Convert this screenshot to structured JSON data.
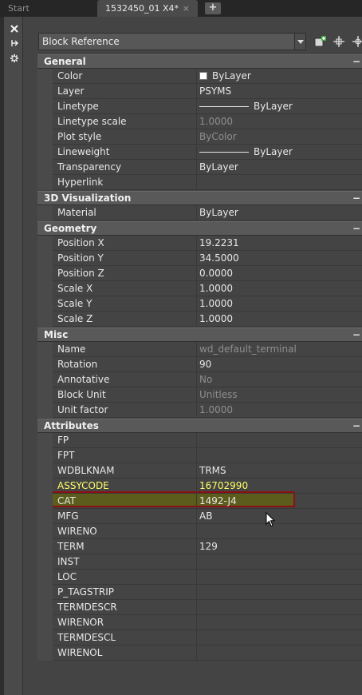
{
  "tabs": [
    {
      "label": "Start"
    },
    {
      "label": "1532450_01 X4*",
      "close": "×"
    }
  ],
  "new_tab": "+",
  "palette_icons": [
    "close-icon",
    "auto-hide-icon",
    "properties-settings-icon"
  ],
  "object_type": "Block Reference",
  "toolbar_icons": [
    "toggle-pickadd-icon",
    "select-objects-icon",
    "quick-select-icon"
  ],
  "colors": {
    "background": "#444444",
    "category_header": "#595959",
    "selected_text": "#ffff66",
    "selected_row_fill": "#5c5d1c",
    "highlight_border": "#8c0f12"
  },
  "categories": [
    {
      "title": "General",
      "toggle": "−",
      "rows": [
        {
          "name": "Color",
          "value": "ByLayer",
          "swatch": "white"
        },
        {
          "name": "Layer",
          "value": "PSYMS"
        },
        {
          "name": "Linetype",
          "value": "ByLayer",
          "line": "long"
        },
        {
          "name": "Linetype scale",
          "value": "1.0000",
          "muted": true
        },
        {
          "name": "Plot style",
          "value": "ByColor",
          "muted": true
        },
        {
          "name": "Lineweight",
          "value": "ByLayer",
          "line": "long"
        },
        {
          "name": "Transparency",
          "value": "ByLayer"
        },
        {
          "name": "Hyperlink",
          "value": ""
        }
      ]
    },
    {
      "title": "3D Visualization",
      "toggle": "−",
      "rows": [
        {
          "name": "Material",
          "value": "ByLayer"
        }
      ]
    },
    {
      "title": "Geometry",
      "toggle": "−",
      "rows": [
        {
          "name": "Position X",
          "value": "19.2231"
        },
        {
          "name": "Position Y",
          "value": "34.5000"
        },
        {
          "name": "Position Z",
          "value": "0.0000"
        },
        {
          "name": "Scale X",
          "value": "1.0000"
        },
        {
          "name": "Scale Y",
          "value": "1.0000"
        },
        {
          "name": "Scale Z",
          "value": "1.0000"
        }
      ]
    },
    {
      "title": "Misc",
      "toggle": "−",
      "rows": [
        {
          "name": "Name",
          "value": "wd_default_terminal",
          "muted": true
        },
        {
          "name": "Rotation",
          "value": "90"
        },
        {
          "name": "Annotative",
          "value": "No",
          "muted": true
        },
        {
          "name": "Block Unit",
          "value": "Unitless",
          "muted": true
        },
        {
          "name": "Unit factor",
          "value": "1.0000",
          "muted": true
        }
      ]
    },
    {
      "title": "Attributes",
      "toggle": "−",
      "rows": [
        {
          "name": "FP",
          "value": ""
        },
        {
          "name": "FPT",
          "value": ""
        },
        {
          "name": "WDBLKNAM",
          "value": "TRMS"
        },
        {
          "name": "ASSYCODE",
          "value": "16702990",
          "selected": true
        },
        {
          "name": "CAT",
          "value": "1492-J4"
        },
        {
          "name": "MFG",
          "value": "AB"
        },
        {
          "name": "WIRENO",
          "value": ""
        },
        {
          "name": "TERM",
          "value": "129"
        },
        {
          "name": "INST",
          "value": ""
        },
        {
          "name": "LOC",
          "value": ""
        },
        {
          "name": "P_TAGSTRIP",
          "value": ""
        },
        {
          "name": "TERMDESCR",
          "value": ""
        },
        {
          "name": "WIRENOR",
          "value": ""
        },
        {
          "name": "TERMDESCL",
          "value": ""
        },
        {
          "name": "WIRENOL",
          "value": ""
        }
      ]
    }
  ]
}
